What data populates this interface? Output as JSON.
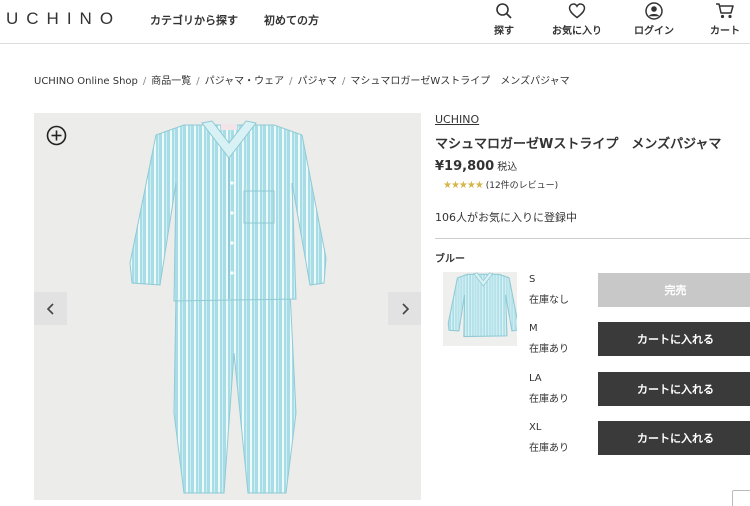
{
  "header": {
    "logo": "UCHINO",
    "nav": [
      "カテゴリから探す",
      "初めての方"
    ],
    "icons": [
      {
        "name": "search-icon",
        "label": "探す"
      },
      {
        "name": "heart-icon",
        "label": "お気に入り"
      },
      {
        "name": "user-icon",
        "label": "ログイン"
      },
      {
        "name": "cart-icon",
        "label": "カート"
      }
    ]
  },
  "breadcrumb": [
    "UCHINO Online Shop",
    "商品一覧",
    "パジャマ・ウェア",
    "パジャマ",
    "マシュマロガーゼWストライプ　メンズパジャマ"
  ],
  "product": {
    "brand": "UCHINO",
    "name": "マシュマロガーゼWストライプ　メンズパジャマ",
    "price": "¥19,800",
    "tax_label": "税込",
    "rating": 4.5,
    "stars": "★★★★★",
    "review_text": "(12件のレビュー)",
    "favorites": "106人がお気に入りに登録中",
    "color": "ブルー",
    "colors": {
      "garment": "#a9dde6",
      "stripe": "#f4fbfc",
      "accent": "#3a3a3a"
    }
  },
  "sizes": [
    {
      "size": "S",
      "stock": "在庫なし",
      "button": "完売",
      "available": false
    },
    {
      "size": "M",
      "stock": "在庫あり",
      "button": "カートに入れる",
      "available": true
    },
    {
      "size": "LA",
      "stock": "在庫あり",
      "button": "カートに入れる",
      "available": true
    },
    {
      "size": "XL",
      "stock": "在庫あり",
      "button": "カートに入れる",
      "available": true
    }
  ]
}
